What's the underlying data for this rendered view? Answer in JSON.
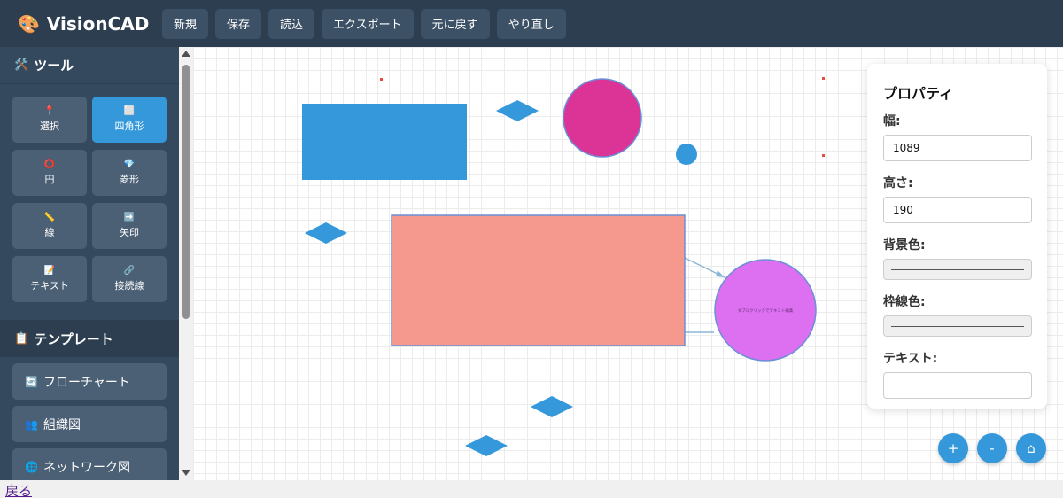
{
  "app": {
    "title": "VisionCAD",
    "logo_icon": "palette-icon"
  },
  "toolbar": {
    "buttons": [
      "新規",
      "保存",
      "読込",
      "エクスポート",
      "元に戻す",
      "やり直し"
    ]
  },
  "sidebar": {
    "tools_title": "ツール",
    "tools": [
      {
        "label": "選択",
        "icon": "📍"
      },
      {
        "label": "四角形",
        "icon": "⬜"
      },
      {
        "label": "円",
        "icon": "⭕"
      },
      {
        "label": "菱形",
        "icon": "💎"
      },
      {
        "label": "線",
        "icon": "📏"
      },
      {
        "label": "矢印",
        "icon": "➡️"
      },
      {
        "label": "テキスト",
        "icon": "📝"
      },
      {
        "label": "接続線",
        "icon": "🔗"
      }
    ],
    "active_tool": "四角形",
    "templates_title": "テンプレート",
    "templates": [
      {
        "label": "フローチャート",
        "icon": "🔄"
      },
      {
        "label": "組織図",
        "icon": "👥"
      },
      {
        "label": "ネットワーク図",
        "icon": "🌐"
      }
    ]
  },
  "canvas": {
    "circle_text": "ダブルクリックでテキスト編集"
  },
  "properties": {
    "title": "プロパティ",
    "width_label": "幅:",
    "width_value": "1089",
    "height_label": "高さ:",
    "height_value": "190",
    "bg_label": "背景色:",
    "border_label": "枠線色:",
    "text_label": "テキスト:",
    "text_value": ""
  },
  "zoom": {
    "in": "+",
    "out": "-",
    "home": "⌂"
  },
  "footer": {
    "back_link": "戻る"
  },
  "colors": {
    "header": "#2c3e50",
    "sidebar": "#34495e",
    "accent": "#3498db",
    "salmon": "#f5998f",
    "magenta": "#dc3397",
    "violet": "#dc70f0"
  }
}
